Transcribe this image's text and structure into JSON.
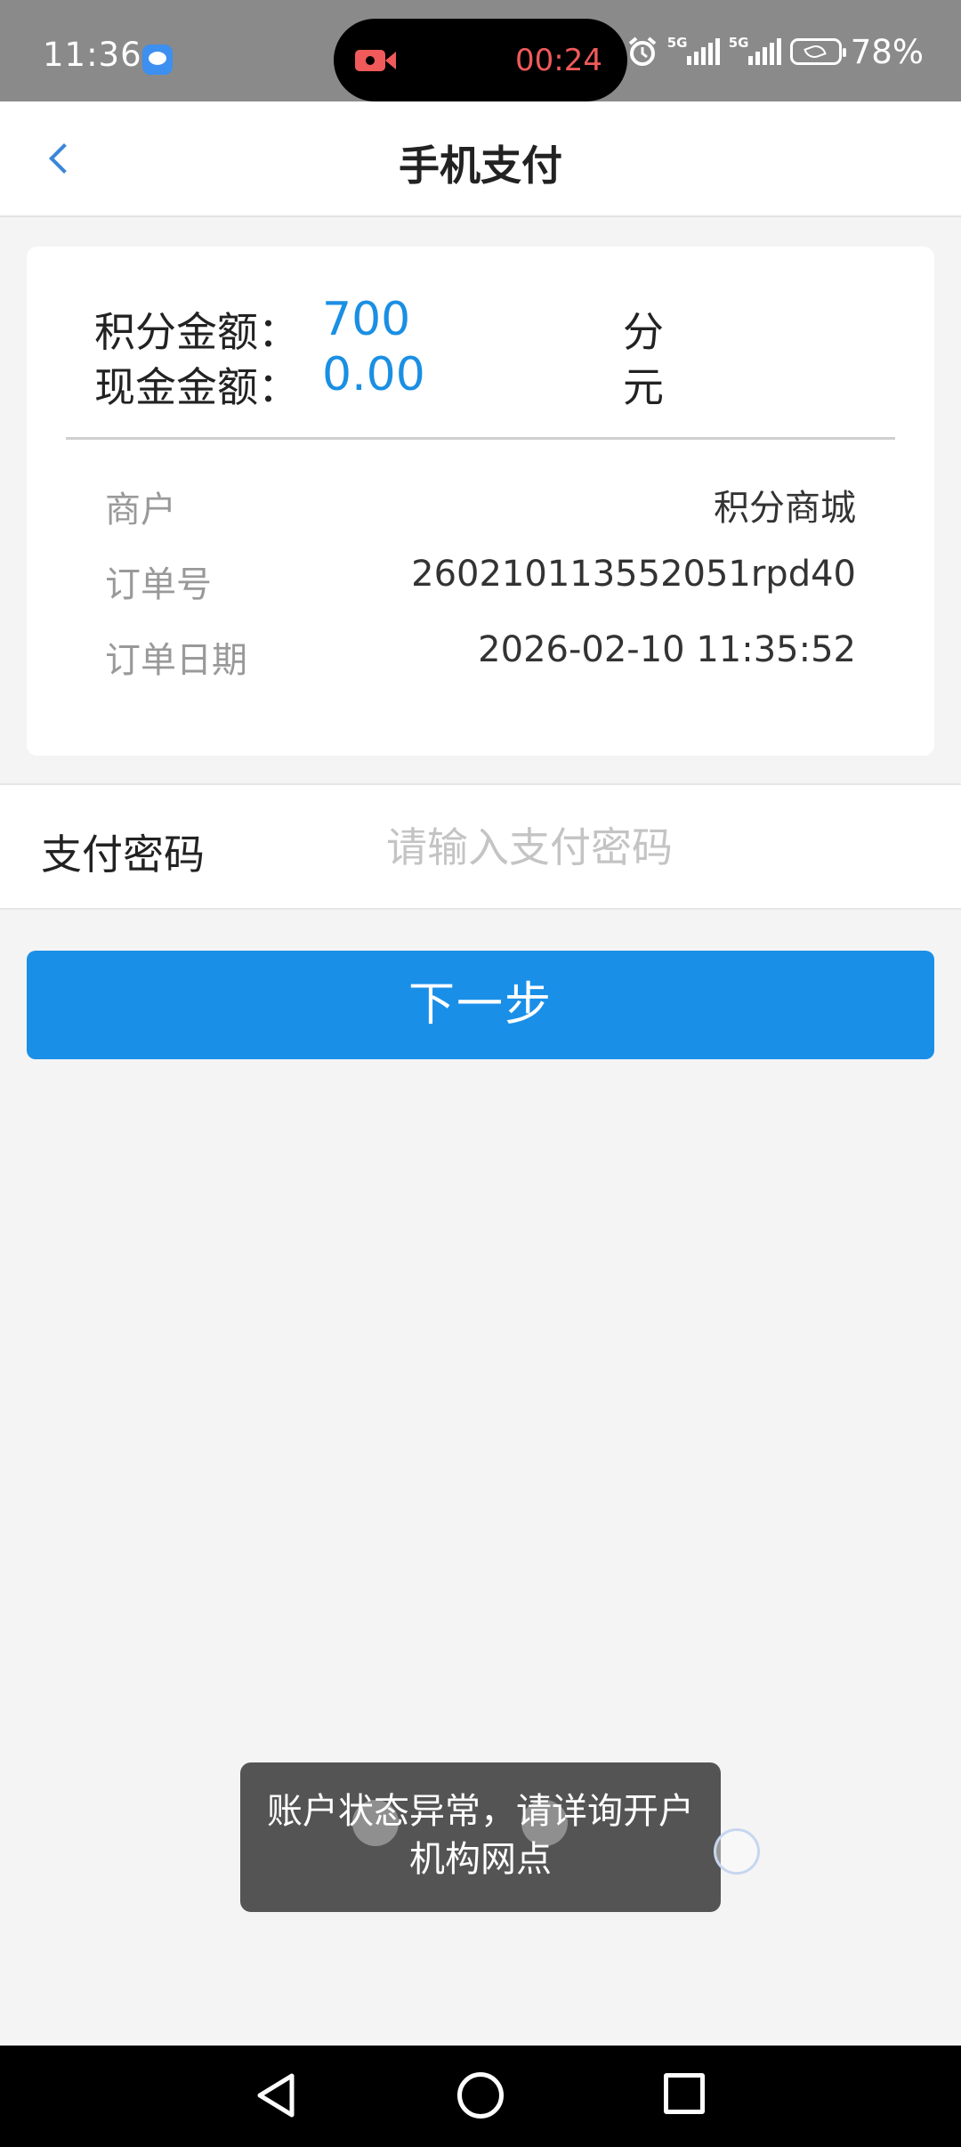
{
  "status_bar": {
    "time": "11:36",
    "recording_time": "00:24",
    "network_1": "5G",
    "network_2": "5G",
    "battery": "78%"
  },
  "header": {
    "title": "手机支付"
  },
  "amounts": {
    "points_label": "积分金额：",
    "points_value": "700",
    "points_unit": "分",
    "cash_label": "现金金额：",
    "cash_value": "0.00",
    "cash_unit": "元"
  },
  "order": {
    "merchant_label": "商户",
    "merchant_value": "积分商城",
    "order_no_label": "订单号",
    "order_no_value": "260210113552051rpd40",
    "order_date_label": "订单日期",
    "order_date_value": "2026-02-10 11:35:52"
  },
  "password": {
    "label": "支付密码",
    "placeholder": "请输入支付密码",
    "value": ""
  },
  "next_button": "下一步",
  "toast": "账户状态异常，请详询开户机构网点",
  "colors": {
    "accent": "#1a8fe8",
    "amount_text": "#1a8fe3",
    "status_bar": "#8a8a8a",
    "recording": "#f05a5a"
  },
  "icons": [
    "chat-bubble-icon",
    "video-record-icon",
    "alarm-icon",
    "signal-icon",
    "battery-icon",
    "back-chevron-icon",
    "nav-back-icon",
    "nav-home-icon",
    "nav-recent-icon"
  ]
}
